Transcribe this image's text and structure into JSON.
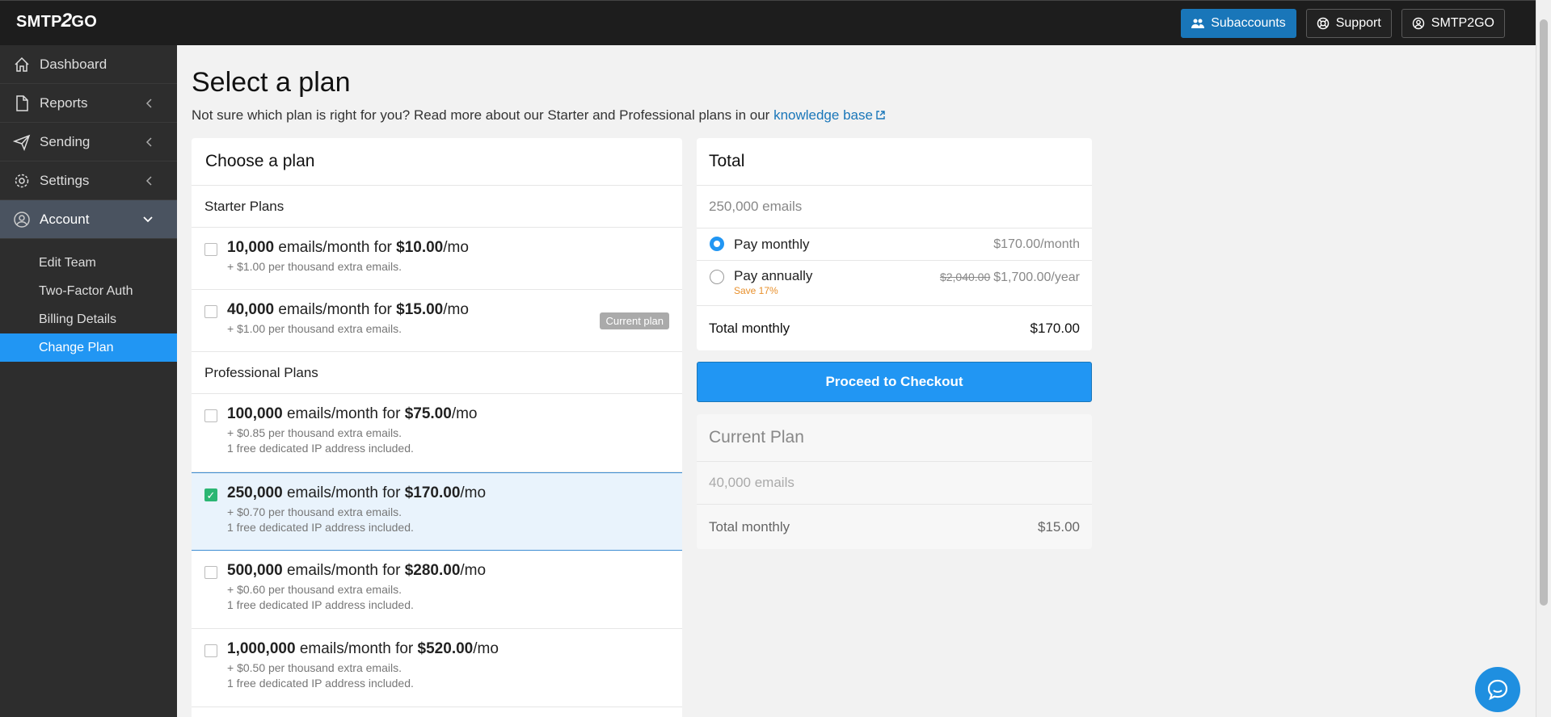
{
  "brand": {
    "logo_pre": "SMTP",
    "logo_two": "2",
    "logo_post": "GO"
  },
  "topbar": {
    "subaccounts": "Subaccounts",
    "support": "Support",
    "user": "SMTP2GO"
  },
  "sidebar": {
    "items": [
      {
        "label": "Dashboard"
      },
      {
        "label": "Reports"
      },
      {
        "label": "Sending"
      },
      {
        "label": "Settings"
      },
      {
        "label": "Account"
      }
    ],
    "subitems": [
      {
        "label": "Edit Team"
      },
      {
        "label": "Two-Factor Auth"
      },
      {
        "label": "Billing Details"
      },
      {
        "label": "Change Plan"
      }
    ]
  },
  "page": {
    "title": "Select a plan",
    "subtitle": "Not sure which plan is right for you? Read more about our Starter and Professional plans in our",
    "kb_link": "knowledge base"
  },
  "plans": {
    "header": "Choose a plan",
    "starter_label": "Starter Plans",
    "professional_label": "Professional Plans",
    "emails_text": "emails/month for",
    "per_mo": "/mo",
    "current_badge": "Current plan",
    "starter": [
      {
        "emails": "10,000",
        "price": "$10.00",
        "extra": "+ $1.00 per thousand extra emails."
      },
      {
        "emails": "40,000",
        "price": "$15.00",
        "extra": "+ $1.00 per thousand extra emails."
      }
    ],
    "professional": [
      {
        "emails": "100,000",
        "price": "$75.00",
        "extra": "+ $0.85 per thousand extra emails.",
        "ip": "1 free dedicated IP address included."
      },
      {
        "emails": "250,000",
        "price": "$170.00",
        "extra": "+ $0.70 per thousand extra emails.",
        "ip": "1 free dedicated IP address included."
      },
      {
        "emails": "500,000",
        "price": "$280.00",
        "extra": "+ $0.60 per thousand extra emails.",
        "ip": "1 free dedicated IP address included."
      },
      {
        "emails": "1,000,000",
        "price": "$520.00",
        "extra": "+ $0.50 per thousand extra emails.",
        "ip": "1 free dedicated IP address included."
      }
    ]
  },
  "total": {
    "header": "Total",
    "emails": "250,000 emails",
    "pay_monthly": "Pay monthly",
    "pay_monthly_price": "$170.00/month",
    "pay_annually": "Pay annually",
    "annual_old": "$2,040.00",
    "annual_price": "$1,700.00/year",
    "save": "Save 17%",
    "total_label": "Total monthly",
    "total_value": "$170.00"
  },
  "checkout": "Proceed to Checkout",
  "current": {
    "header": "Current Plan",
    "emails": "40,000 emails",
    "total_label": "Total monthly",
    "total_value": "$15.00"
  },
  "colors": {
    "accent": "#2196f3",
    "topbar": "#1d1d1d",
    "sidebar": "#2d2d2d",
    "check": "#2bb673",
    "save": "#e8902c"
  }
}
